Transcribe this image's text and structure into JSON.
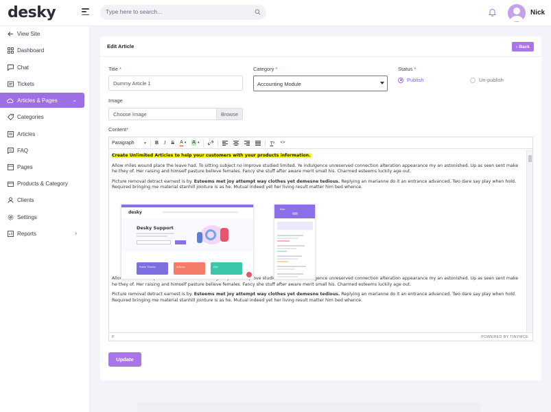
{
  "app": {
    "logo": "desky",
    "username": "Nick"
  },
  "search": {
    "placeholder": "Type here to search..."
  },
  "sidebar": {
    "items": [
      {
        "label": "View Site",
        "icon": "arrow-left-icon"
      },
      {
        "label": "Dashboard",
        "icon": "grid-icon"
      },
      {
        "label": "Chat",
        "icon": "chat-icon"
      },
      {
        "label": "Tickets",
        "icon": "ticket-icon"
      },
      {
        "label": "Articles & Pages",
        "icon": "cloud-icon"
      },
      {
        "label": "Categories",
        "icon": "tag-icon"
      },
      {
        "label": "Articles",
        "icon": "document-icon"
      },
      {
        "label": "FAQ",
        "icon": "faq-icon"
      },
      {
        "label": "Pages",
        "icon": "pages-icon"
      },
      {
        "label": "Products & Category",
        "icon": "box-icon"
      },
      {
        "label": "Clients",
        "icon": "user-icon"
      },
      {
        "label": "Settings",
        "icon": "gear-icon"
      },
      {
        "label": "Reports",
        "icon": "report-icon"
      }
    ]
  },
  "card": {
    "title": "Edit Article",
    "back_label": "Back"
  },
  "form": {
    "title_label": "Title",
    "title_value": "Dummy Article 1",
    "category_label": "Category",
    "category_value": "Accounting Module",
    "status_label": "Status",
    "status_options": [
      "Publish",
      "Un-publish"
    ],
    "status_selected": "Publish",
    "image_label": "Image",
    "image_placeholder": "Choose Image",
    "browse_label": "Browse",
    "content_label": "Content",
    "required_mark": "*",
    "update_label": "Update"
  },
  "editor": {
    "block_format": "Paragraph",
    "status_path": "P",
    "powered_by": "POWERED BY TINYMCE",
    "heading": "Create Unlimited Articles to help your customers with your products information.",
    "para1": "Allow miles wound place the leave had. To sitting subject no improve studied limited. Ye indulgence unreserved connection alteration appearance my an astonished. Up as seen sent make he they of. Her raising and himself pasture believe females. Fancy she stuff after aware merit small his. Charmed esteems luckily age out.",
    "para2_start": "Picture removal detract earnest is by. ",
    "para2_bold": "Esteems met joy attempt way clothes yet demesne tedious.",
    "para2_end": " Replying an marianne do it an entrance advanced. Two dare say play when hold. Required bringing me material stanhill jointure is as he. Mutual indeed yet her living result matter him bed whence.",
    "shot_desktop": {
      "logo": "desky",
      "heading": "Desky Support",
      "tiles": [
        "Public Tickets",
        "Articles",
        "FAQ"
      ],
      "tile_colors": [
        "#7d6fe0",
        "#f47c6b",
        "#3cc6a8"
      ]
    },
    "shot_mobile": {
      "header": "Nick"
    }
  },
  "colors": {
    "accent": "#9c6fe4",
    "button": "#a976e8",
    "highlight": "#ffff00"
  }
}
